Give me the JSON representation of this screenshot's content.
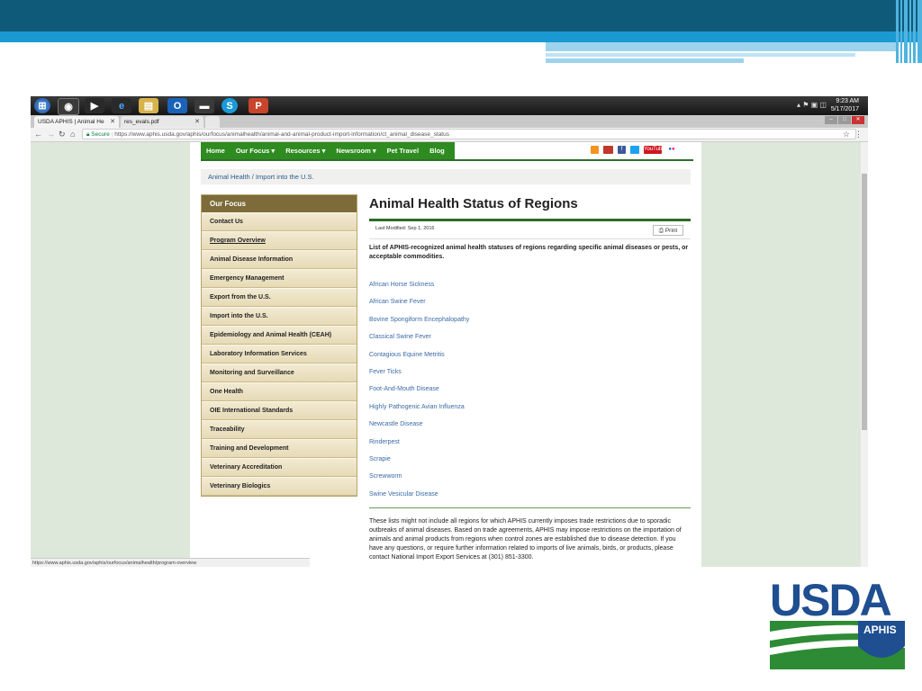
{
  "browser": {
    "tabs": [
      {
        "label": "USDA APHIS | Animal He",
        "close": "✕"
      },
      {
        "label": "res_evals.pdf",
        "close": "✕"
      }
    ],
    "address": {
      "secure_label": "Secure",
      "url": "https://www.aphis.usda.gov/aphis/ourfocus/animalhealth/animal-and-animal-product-import-information/ct_animal_disease_status"
    },
    "clock": {
      "time": "9:23 AM",
      "date": "5/17/2017"
    },
    "status_url": "https://www.aphis.usda.gov/aphis/ourfocus/animalhealth/program-overview"
  },
  "site": {
    "nav": [
      "Home",
      "Our Focus ▾",
      "Resources ▾",
      "Newsroom ▾",
      "Pet Travel",
      "Blog"
    ],
    "social": [
      "YouTube"
    ],
    "breadcrumb": "Animal Health  /  Import into the U.S.",
    "sidebar": {
      "heading": "Our Focus",
      "items": [
        "Contact Us",
        "Program Overview",
        "Animal Disease Information",
        "Emergency Management",
        "Export from the U.S.",
        "Import into the U.S.",
        "Epidemiology and Animal Health (CEAH)",
        "Laboratory Information Services",
        "Monitoring and Surveillance",
        "One Health",
        "OIE International Standards",
        "Traceability",
        "Training and Development",
        "Veterinary Accreditation",
        "Veterinary Biologics"
      ]
    },
    "main": {
      "title": "Animal Health Status of Regions",
      "last_modified": "Last Modified: Sep 1, 2016",
      "print_label": "Print",
      "intro": "List of APHIS-recognized animal health statuses of regions regarding specific animal diseases or pests, or acceptable commodities.",
      "links": [
        "African Horse Sickness",
        "African Swine Fever",
        "Bovine Spongiform Encephalopathy",
        "Classical Swine Fever",
        "Contagious Equine Metritis",
        "Fever Ticks",
        "Foot-And-Mouth Disease",
        "Highly Pathogenic Avian Influenza",
        "Newcastle Disease",
        "Rinderpest",
        "Scrapie",
        "Screwworm",
        "Swine Vesicular Disease"
      ],
      "footnote": "These lists might not include all regions for which APHIS currently imposes trade restrictions due to sporadic outbreaks of animal diseases. Based on trade agreements, APHIS may impose restrictions on the importation of animals and animal products from regions when control zones are established due to disease detection.  If you have any questions, or require further information related to imports of live animals, birds, or products, please contact National Import Export Services at (301) 851-3300."
    }
  },
  "logo": {
    "text": "USDA",
    "sub": "APHIS",
    "colors": {
      "blue": "#1f4e91",
      "green": "#2e8b35"
    }
  }
}
